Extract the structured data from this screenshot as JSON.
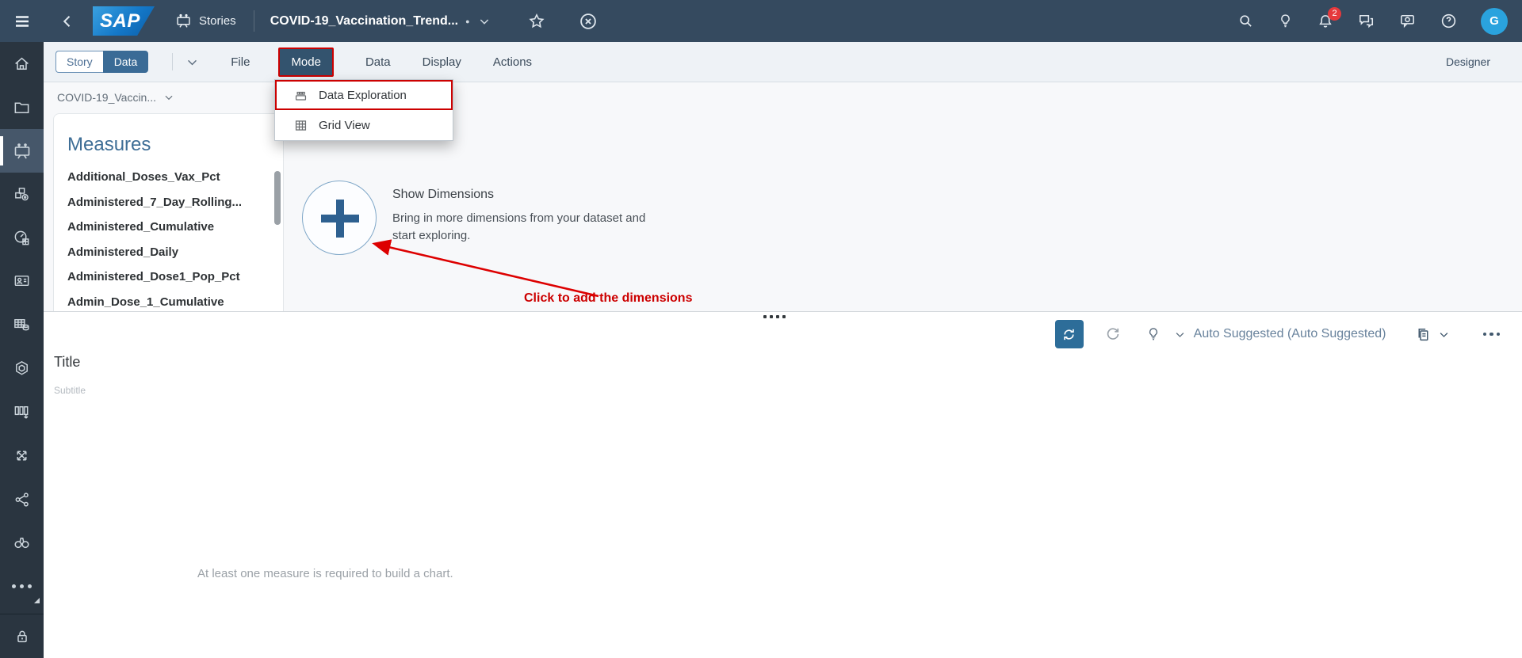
{
  "shell": {
    "brand": "SAP",
    "nav_section": "Stories",
    "document_title": "COVID-19_Vaccination_Trend...",
    "unsaved_dot": "●",
    "notifications_badge": "2",
    "avatar_initial": "G"
  },
  "toolbar": {
    "view_tabs": [
      {
        "label": "Story"
      },
      {
        "label": "Data"
      }
    ],
    "selected_view_tab": "Data",
    "menus": [
      "File",
      "Mode",
      "Data",
      "Display",
      "Actions"
    ],
    "open_menu": "Mode",
    "designer_label": "Designer"
  },
  "mode_menu": {
    "items": [
      {
        "label": "Data Exploration",
        "icon": "data-exploration-icon",
        "annotated": true
      },
      {
        "label": "Grid View",
        "icon": "grid-view-icon",
        "annotated": false
      }
    ]
  },
  "data_panel": {
    "dataset_name": "COVID-19_Vaccin...",
    "section_title": "Measures",
    "measures": [
      "Additional_Doses_Vax_Pct",
      "Administered_7_Day_Rolling...",
      "Administered_Cumulative",
      "Administered_Daily",
      "Administered_Dose1_Pop_Pct",
      "Admin_Dose_1_Cumulative"
    ]
  },
  "exploration": {
    "empty_state_title": "Show Dimensions",
    "empty_state_description_line1": "Bring in more dimensions from your dataset and",
    "empty_state_description_line2": "start exploring."
  },
  "annotation": {
    "label": "Click to add the dimensions",
    "color": "#cc0000"
  },
  "chart_toolbar": {
    "auto_suggested_label": "Auto Suggested (Auto Suggested)"
  },
  "chart_canvas": {
    "title": "Title",
    "subtitle": "Subtitle",
    "empty_message": "At least one measure is required to build a chart."
  },
  "colors": {
    "shell_bg": "#354a5f",
    "sidebar_bg": "#2a3540",
    "accent_blue": "#3a6b96",
    "annotation_red": "#cc0000",
    "refresh_button_bg": "#2d6d99"
  }
}
